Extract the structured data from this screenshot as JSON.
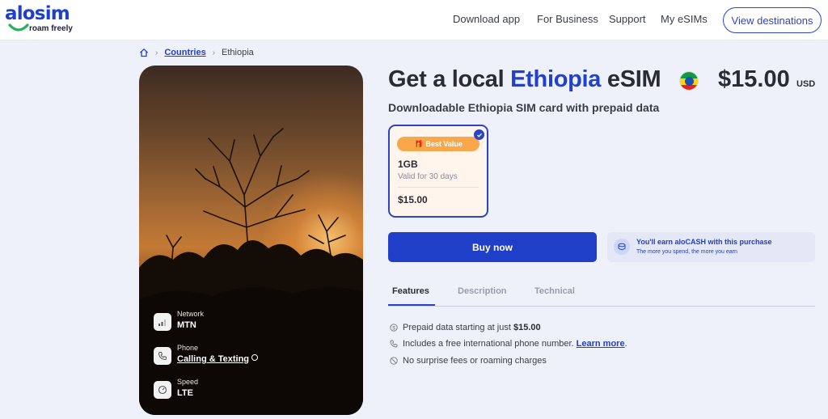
{
  "header": {
    "logo_text": "alosim",
    "logo_tagline": "roam freely",
    "nav": [
      "Download app",
      "For Business",
      "Support",
      "My eSIMs"
    ],
    "cta_label": "View destinations",
    "brand_color": "#1f3fd0",
    "swoosh_color": "#25b35a"
  },
  "breadcrumb": {
    "home_icon": "home-icon",
    "link_label": "Countries",
    "current_label": "Ethiopia"
  },
  "hero": {
    "specs": [
      {
        "label": "Network",
        "value": "MTN",
        "icon": "signal-icon"
      },
      {
        "label": "Phone",
        "value": "Calling & Texting",
        "icon": "phone-icon"
      },
      {
        "label": "Speed",
        "value": "LTE",
        "icon": "speedometer-icon"
      }
    ]
  },
  "product": {
    "title_prefix": "Get a local ",
    "title_country": "Ethiopia",
    "title_suffix": " eSIM",
    "price": "$15.00",
    "currency": "USD",
    "subtitle": "Downloadable Ethiopia SIM card with prepaid data",
    "flag_icon": "ethiopia-flag-icon"
  },
  "plan": {
    "badge": "Best Value",
    "badge_icon": "🎁",
    "data": "1GB",
    "validity": "Valid for 30 days",
    "price": "$15.00",
    "selected": true,
    "accent": "#2a44c8",
    "badge_color": "#f8a74a"
  },
  "buy": {
    "label": "Buy now",
    "color": "#1f3fc8"
  },
  "cash": {
    "title": "You'll earn aloCASH with this purchase",
    "subtitle": "The more you spend, the more you earn"
  },
  "tabs": [
    {
      "label": "Features",
      "active": true
    },
    {
      "label": "Description",
      "active": false
    },
    {
      "label": "Technical",
      "active": false
    }
  ],
  "features": {
    "f1_text": "Prepaid data starting at just ",
    "f1_price": "$15.00",
    "f2_text": "Includes a free international phone number. ",
    "f2_link": "Learn more",
    "f2_tail": ".",
    "f3_text": "No surprise fees or roaming charges"
  }
}
